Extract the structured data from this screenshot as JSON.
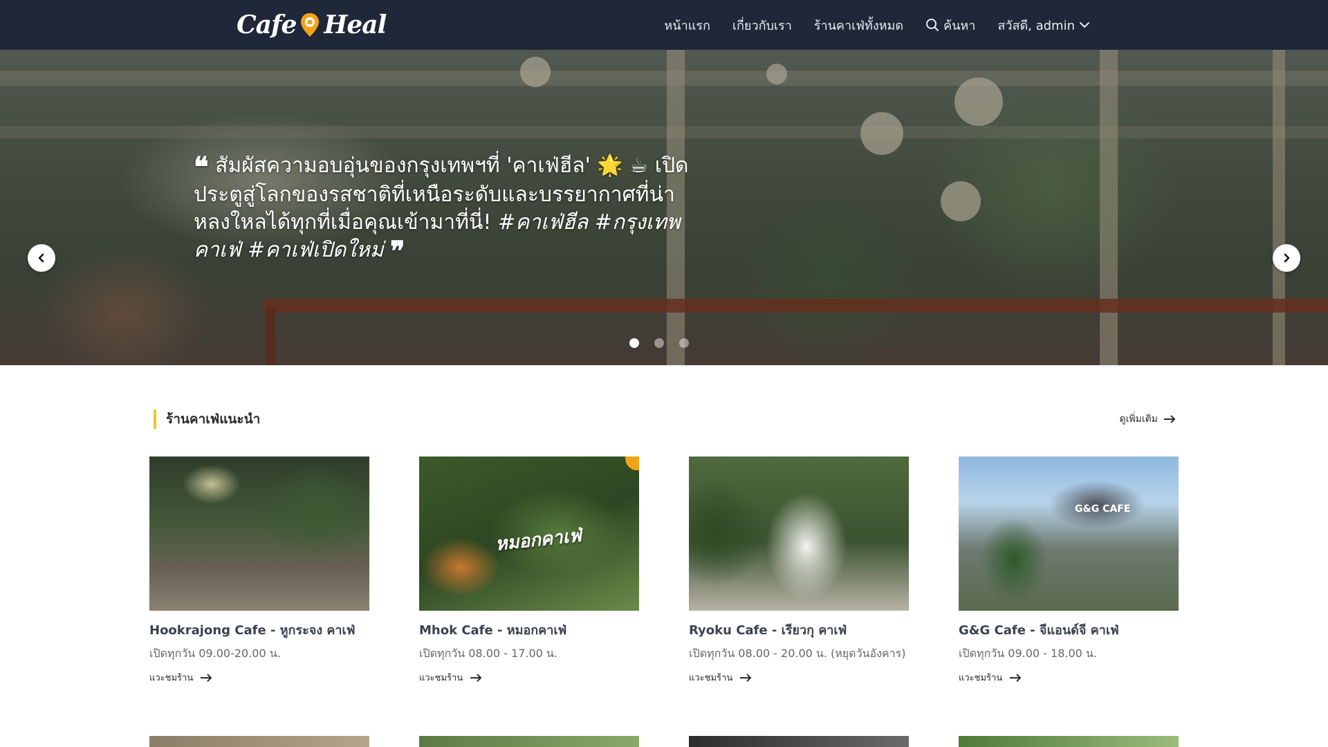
{
  "header": {
    "brand_left": "Cafe",
    "brand_right": "Heal",
    "nav": [
      {
        "label": "หน้าแรก"
      },
      {
        "label": "เกี่ยวกับเรา"
      },
      {
        "label": "ร้านคาเฟ่ทั้งหมด"
      },
      {
        "label": "ค้นหา",
        "icon": "search-icon"
      },
      {
        "label": "สวัสดี, admin",
        "icon": "chevron-down-icon"
      }
    ]
  },
  "hero": {
    "quote_text": "สัมผัสความอบอุ่นของกรุงเทพฯที่ 'คาเฟ่ฮีล' 🌟 ☕ เปิดประตูสู่โลกของรสชาติที่เหนือระดับและบรรยากาศที่น่าหลงใหลได้ทุกที่เมื่อคุณเข้ามาที่นี่!",
    "quote_tags": "#คาเฟ่ฮีล #กรุงเทพคาเฟ่ #คาเฟ่เปิดใหม่",
    "open_quote": "❝",
    "close_quote": "❞",
    "slides": 3,
    "active_slide": 1
  },
  "recommended": {
    "title": "ร้านคาเฟ่แนะนำ",
    "see_more": "ดูเพิ่มเติม",
    "cards": [
      {
        "title": "Hookrajong Cafe - หูกระจง คาเฟ่",
        "hours": "เปิดทุกวัน 09.00-20.00 น.",
        "link": "แวะชมร้าน"
      },
      {
        "title": "Mhok Cafe - หมอกคาเฟ่",
        "hours": "เปิดทุกวัน 08.00 - 17.00 น.",
        "link": "แวะชมร้าน",
        "image_text": "หมอกคาเฟ่"
      },
      {
        "title": "Ryoku Cafe - เรียวกุ คาเฟ่",
        "hours": "เปิดทุกวัน 08.00 - 20.00 น. (หยุดวันอังคาร)",
        "link": "แวะชมร้าน"
      },
      {
        "title": "G&G Cafe - จีแอนด์จี คาเฟ่",
        "hours": "เปิดทุกวัน 09.00 - 18.00 น.",
        "link": "แวะชมร้าน",
        "image_text": "G&G CAFE"
      }
    ]
  },
  "colors": {
    "nav_bg": "#1f2838",
    "accent": "#f2c230",
    "brand_pin": "#f2a318"
  }
}
